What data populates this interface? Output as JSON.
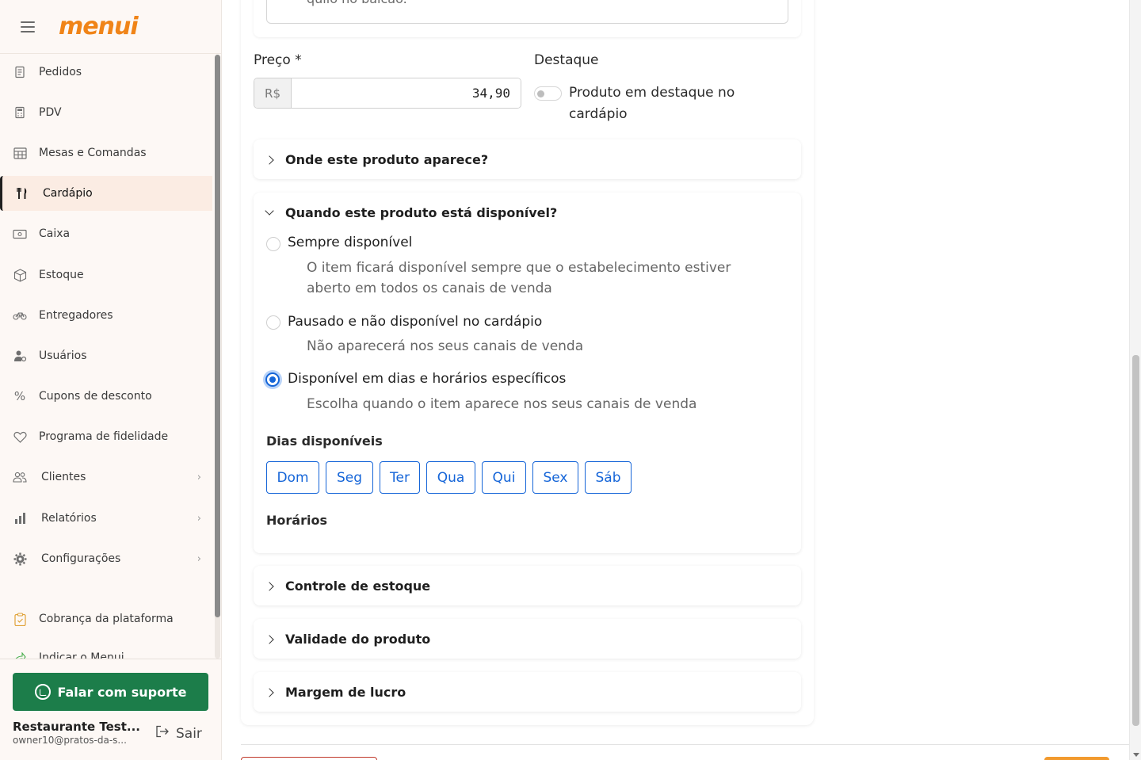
{
  "app": {
    "logo": "menui"
  },
  "sidebar": {
    "items": [
      {
        "label": "Pedidos",
        "icon": "receipt-icon"
      },
      {
        "label": "PDV",
        "icon": "calculator-icon"
      },
      {
        "label": "Mesas e Comandas",
        "icon": "table-icon"
      },
      {
        "label": "Cardápio",
        "icon": "fork-knife-icon",
        "active": true
      },
      {
        "label": "Caixa",
        "icon": "cash-icon"
      },
      {
        "label": "Estoque",
        "icon": "box-icon"
      },
      {
        "label": "Entregadores",
        "icon": "bike-icon"
      },
      {
        "label": "Usuários",
        "icon": "user-gear-icon"
      },
      {
        "label": "Cupons de desconto",
        "icon": "percent-icon"
      },
      {
        "label": "Programa de fidelidade",
        "icon": "heart-icon"
      },
      {
        "label": "Clientes",
        "icon": "users-icon",
        "expandable": true
      },
      {
        "label": "Relatórios",
        "icon": "bar-chart-icon",
        "expandable": true
      },
      {
        "label": "Configurações",
        "icon": "gear-icon",
        "expandable": true
      },
      {
        "label": "Cobrança da plataforma",
        "icon": "clipboard-icon"
      },
      {
        "label": "Indicar o Menui",
        "icon": "share-icon"
      }
    ],
    "support_button": "Falar com suporte",
    "user": {
      "name": "Restaurante Test...",
      "email": "owner10@pratos-da-s..."
    },
    "logout_label": "Sair"
  },
  "form": {
    "textarea_partial": "quilo no balcão.",
    "price": {
      "label": "Preço *",
      "prefix": "R$",
      "value": "34,90"
    },
    "featured": {
      "label": "Destaque",
      "toggle_text": "Produto em destaque no cardápio",
      "enabled": false
    },
    "section_where": "Onde este produto aparece?",
    "section_when": "Quando este produto está disponível?",
    "availability_options": [
      {
        "title": "Sempre disponível",
        "desc": "O item ficará disponível sempre que o estabelecimento estiver aberto em todos os canais de venda",
        "checked": false
      },
      {
        "title": "Pausado e não disponível no cardápio",
        "desc": "Não aparecerá nos seus canais de venda",
        "checked": false
      },
      {
        "title": "Disponível em dias e horários específicos",
        "desc": "Escolha quando o item aparece nos seus canais de venda",
        "checked": true
      }
    ],
    "days_label": "Dias disponíveis",
    "days": [
      "Dom",
      "Seg",
      "Ter",
      "Qua",
      "Qui",
      "Sex",
      "Sáb"
    ],
    "hours_label": "Horários",
    "section_stock": "Controle de estoque",
    "section_validity": "Validade do produto",
    "section_margin": "Margem de lucro"
  },
  "colors": {
    "brand": "#f08418",
    "accent_blue": "#1565d8",
    "support_green": "#1c7d4a"
  }
}
